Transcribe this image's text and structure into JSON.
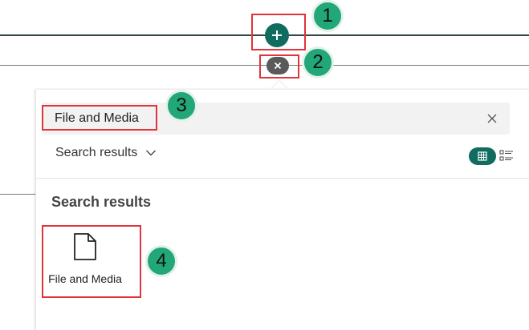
{
  "toolbar": {
    "add_icon": "plus-icon",
    "close_icon": "close-icon"
  },
  "search": {
    "value": "File and Media",
    "clear_icon": "close-icon"
  },
  "filter": {
    "label": "Search results",
    "icon": "chevron-down-icon"
  },
  "view_toggle": {
    "grid_icon": "grid-icon",
    "list_icon": "list-icon"
  },
  "results": {
    "title": "Search results",
    "items": [
      {
        "label": "File and Media",
        "icon": "document-icon"
      }
    ]
  },
  "callouts": [
    "1",
    "2",
    "3",
    "4"
  ],
  "colors": {
    "accent": "#0f6c5f",
    "callout_border": "#e0343a",
    "badge": "#22a779"
  }
}
